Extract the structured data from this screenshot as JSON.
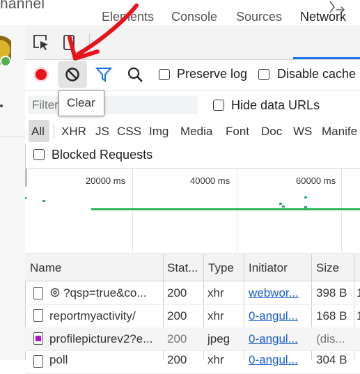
{
  "page": {
    "channel_text": "hannel"
  },
  "tabs": {
    "elements": "Elements",
    "console": "Console",
    "sources": "Sources",
    "network": "Network"
  },
  "toolbar": {
    "preserve_log": "Preserve log",
    "disable_cache": "Disable cache",
    "tooltip": "Clear"
  },
  "filter": {
    "placeholder": "Filter",
    "hide_data_urls": "Hide data URLs"
  },
  "types": [
    "All",
    "XHR",
    "JS",
    "CSS",
    "Img",
    "Media",
    "Font",
    "Doc",
    "WS",
    "Manife"
  ],
  "blocked_requests": "Blocked Requests",
  "overview": {
    "ticks": [
      "20000 ms",
      "40000 ms",
      "60000 ms"
    ]
  },
  "table": {
    "headers": {
      "name": "Name",
      "status": "Stat...",
      "type": "Type",
      "initiator": "Initiator",
      "size": "Size"
    },
    "rows": [
      {
        "name": "?qsp=true&co...",
        "status": "200",
        "type": "xhr",
        "initiator": "webwor...",
        "size": "398 B",
        "extra": "1",
        "icon": "gear-icon"
      },
      {
        "name": "reportmyactivity/",
        "status": "200",
        "type": "xhr",
        "initiator": "0-angul...",
        "size": "168 B",
        "extra": "1",
        "icon": "file-icon"
      },
      {
        "name": "profilepicturev2?e...",
        "status": "200",
        "type": "jpeg",
        "initiator": "0-angul...",
        "size": "(dis...",
        "extra": "",
        "icon": "image-icon"
      },
      {
        "name": "poll",
        "status": "200",
        "type": "xhr",
        "initiator": "0-angul...",
        "size": "304 B",
        "extra": "",
        "icon": "file-icon"
      }
    ]
  },
  "colors": {
    "record": "#e8141b",
    "accent": "#1a73e8",
    "waterfall": "#2db55d",
    "annotation": "#e8141b"
  }
}
